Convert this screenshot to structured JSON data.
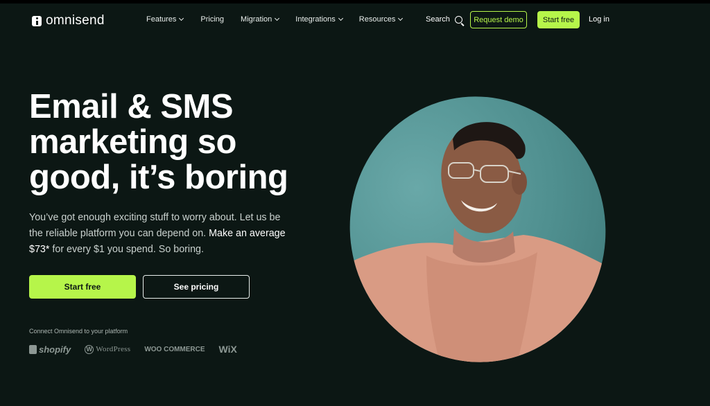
{
  "brand": {
    "name": "omnisend"
  },
  "nav": {
    "items": [
      {
        "label": "Features",
        "has_dropdown": true
      },
      {
        "label": "Pricing",
        "has_dropdown": false
      },
      {
        "label": "Migration",
        "has_dropdown": true
      },
      {
        "label": "Integrations",
        "has_dropdown": true
      },
      {
        "label": "Resources",
        "has_dropdown": true
      }
    ],
    "search_label": "Search",
    "request_demo_label": "Request demo",
    "start_free_label": "Start free",
    "login_label": "Log in"
  },
  "hero": {
    "headline": "Email & SMS marketing so good, it’s boring",
    "subtext_part1": "You’ve got enough exciting stuff to worry about. Let us be the reliable platform you can depend on. ",
    "subtext_highlight": "Make an average $73*",
    "subtext_part2": " for every $1 you spend. So boring.",
    "primary_button": "Start free",
    "secondary_button": "See pricing",
    "connect_label": "Connect Omnisend to your platform",
    "platforms": [
      "shopify",
      "WordPress",
      "WOO COMMERCE",
      "WiX"
    ]
  },
  "colors": {
    "background": "#0c1714",
    "accent": "#b6f54a",
    "image_bg": "#5e9e9e"
  }
}
